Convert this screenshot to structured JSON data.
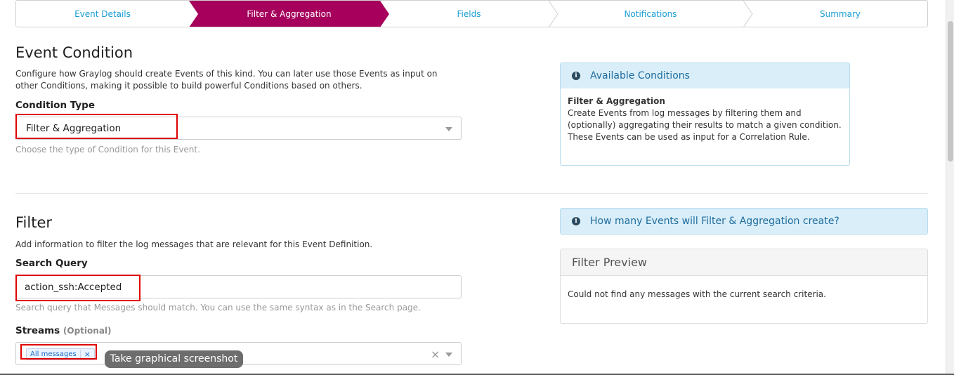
{
  "wizard": {
    "steps": [
      {
        "label": "Event Details"
      },
      {
        "label": "Filter & Aggregation"
      },
      {
        "label": "Fields"
      },
      {
        "label": "Notifications"
      },
      {
        "label": "Summary"
      }
    ],
    "active_index": 1,
    "active_color": "#a6005c",
    "link_color": "#1a9ed4"
  },
  "event_condition": {
    "title": "Event Condition",
    "description": "Configure how Graylog should create Events of this kind. You can later use those Events as input on other Conditions, making it possible to build powerful Conditions based on others.",
    "condition_type_label": "Condition Type",
    "condition_type_value": "Filter & Aggregation",
    "condition_type_help": "Choose the type of Condition for this Event."
  },
  "available_conditions": {
    "title": "Available Conditions",
    "item_title": "Filter & Aggregation",
    "item_text": "Create Events from log messages by filtering them and (optionally) aggregating their results to match a given condition. These Events can be used as input for a Correlation Rule."
  },
  "filter": {
    "title": "Filter",
    "description": "Add information to filter the log messages that are relevant for this Event Definition.",
    "search_query_label": "Search Query",
    "search_query_value": "action_ssh:Accepted",
    "search_query_help": "Search query that Messages should match. You can use the same syntax as in the Search page.",
    "streams_label": "Streams",
    "streams_optional": "(Optional)",
    "streams_selected": [
      "All messages"
    ],
    "chip_remove": "×",
    "clear_symbol": "×"
  },
  "events_info": {
    "title": "How many Events will Filter & Aggregation create?"
  },
  "filter_preview": {
    "title": "Filter Preview",
    "message": "Could not find any messages with the current search criteria."
  },
  "tooltip": {
    "text": "Take graphical screenshot"
  },
  "icons": {
    "info": "i"
  }
}
